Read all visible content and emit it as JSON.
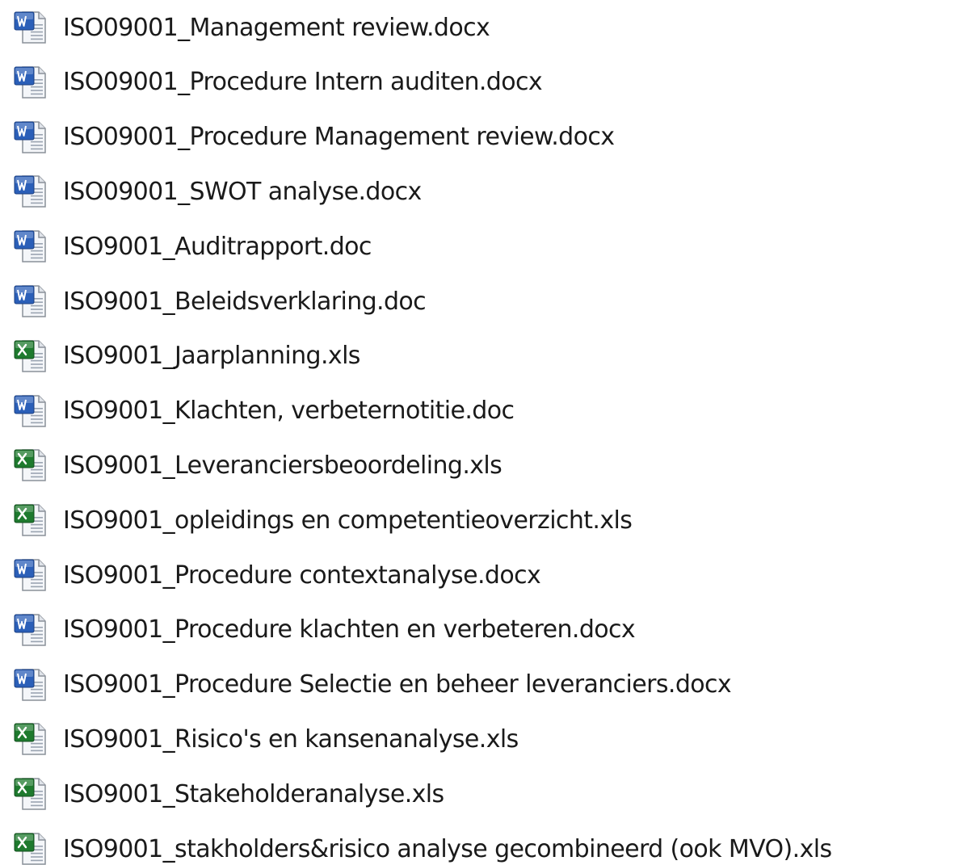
{
  "files": [
    {
      "name": "ISO09001_Management review.docx",
      "icon": "word-document-icon"
    },
    {
      "name": "ISO09001_Procedure Intern auditen.docx",
      "icon": "word-document-icon"
    },
    {
      "name": "ISO09001_Procedure Management review.docx",
      "icon": "word-document-icon"
    },
    {
      "name": "ISO09001_SWOT analyse.docx",
      "icon": "word-document-icon"
    },
    {
      "name": "ISO9001_Auditrapport.doc",
      "icon": "word-document-icon"
    },
    {
      "name": "ISO9001_Beleidsverklaring.doc",
      "icon": "word-document-icon"
    },
    {
      "name": "ISO9001_Jaarplanning.xls",
      "icon": "excel-spreadsheet-icon"
    },
    {
      "name": "ISO9001_Klachten, verbeternotitie.doc",
      "icon": "word-document-icon"
    },
    {
      "name": "ISO9001_Leveranciersbeoordeling.xls",
      "icon": "excel-spreadsheet-icon"
    },
    {
      "name": "ISO9001_opleidings en competentieoverzicht.xls",
      "icon": "excel-spreadsheet-icon"
    },
    {
      "name": "ISO9001_Procedure contextanalyse.docx",
      "icon": "word-document-icon"
    },
    {
      "name": "ISO9001_Procedure klachten en verbeteren.docx",
      "icon": "word-document-icon"
    },
    {
      "name": "ISO9001_Procedure Selectie en beheer leveranciers.docx",
      "icon": "word-document-icon"
    },
    {
      "name": "ISO9001_Risico's en kansenanalyse.xls",
      "icon": "excel-spreadsheet-icon"
    },
    {
      "name": "ISO9001_Stakeholderanalyse.xls",
      "icon": "excel-spreadsheet-icon"
    },
    {
      "name": "ISO9001_stakholders&risico analyse gecombineerd (ook MVO).xls",
      "icon": "excel-spreadsheet-icon"
    }
  ],
  "colors": {
    "word_badge": "#2b5fb8",
    "excel_badge": "#1e7a2e",
    "text": "#1a1a1a"
  }
}
